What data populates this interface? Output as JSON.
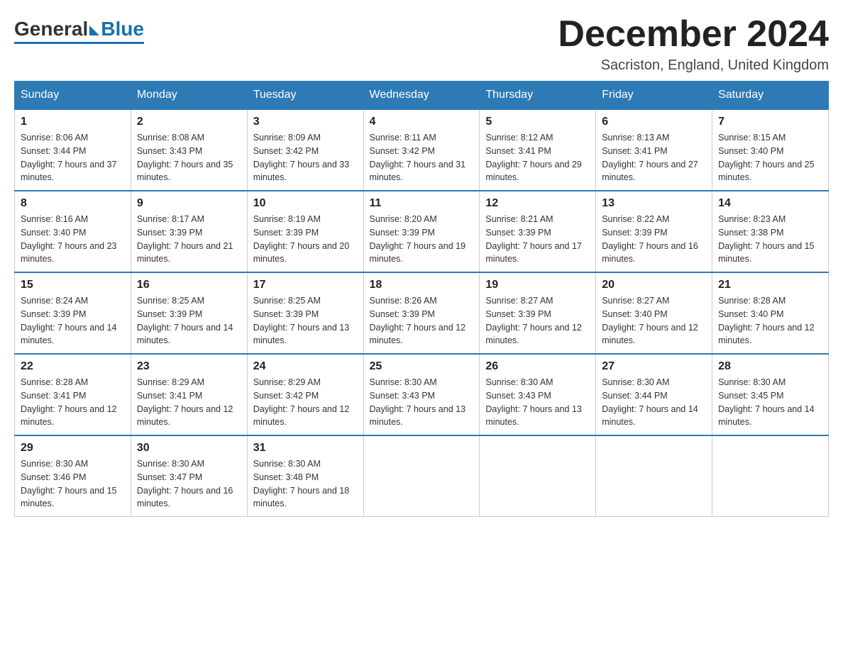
{
  "header": {
    "logo_general": "General",
    "logo_blue": "Blue",
    "month_title": "December 2024",
    "location": "Sacriston, England, United Kingdom"
  },
  "weekdays": [
    "Sunday",
    "Monday",
    "Tuesday",
    "Wednesday",
    "Thursday",
    "Friday",
    "Saturday"
  ],
  "weeks": [
    [
      {
        "day": "1",
        "sunrise": "8:06 AM",
        "sunset": "3:44 PM",
        "daylight": "7 hours and 37 minutes."
      },
      {
        "day": "2",
        "sunrise": "8:08 AM",
        "sunset": "3:43 PM",
        "daylight": "7 hours and 35 minutes."
      },
      {
        "day": "3",
        "sunrise": "8:09 AM",
        "sunset": "3:42 PM",
        "daylight": "7 hours and 33 minutes."
      },
      {
        "day": "4",
        "sunrise": "8:11 AM",
        "sunset": "3:42 PM",
        "daylight": "7 hours and 31 minutes."
      },
      {
        "day": "5",
        "sunrise": "8:12 AM",
        "sunset": "3:41 PM",
        "daylight": "7 hours and 29 minutes."
      },
      {
        "day": "6",
        "sunrise": "8:13 AM",
        "sunset": "3:41 PM",
        "daylight": "7 hours and 27 minutes."
      },
      {
        "day": "7",
        "sunrise": "8:15 AM",
        "sunset": "3:40 PM",
        "daylight": "7 hours and 25 minutes."
      }
    ],
    [
      {
        "day": "8",
        "sunrise": "8:16 AM",
        "sunset": "3:40 PM",
        "daylight": "7 hours and 23 minutes."
      },
      {
        "day": "9",
        "sunrise": "8:17 AM",
        "sunset": "3:39 PM",
        "daylight": "7 hours and 21 minutes."
      },
      {
        "day": "10",
        "sunrise": "8:19 AM",
        "sunset": "3:39 PM",
        "daylight": "7 hours and 20 minutes."
      },
      {
        "day": "11",
        "sunrise": "8:20 AM",
        "sunset": "3:39 PM",
        "daylight": "7 hours and 19 minutes."
      },
      {
        "day": "12",
        "sunrise": "8:21 AM",
        "sunset": "3:39 PM",
        "daylight": "7 hours and 17 minutes."
      },
      {
        "day": "13",
        "sunrise": "8:22 AM",
        "sunset": "3:39 PM",
        "daylight": "7 hours and 16 minutes."
      },
      {
        "day": "14",
        "sunrise": "8:23 AM",
        "sunset": "3:38 PM",
        "daylight": "7 hours and 15 minutes."
      }
    ],
    [
      {
        "day": "15",
        "sunrise": "8:24 AM",
        "sunset": "3:39 PM",
        "daylight": "7 hours and 14 minutes."
      },
      {
        "day": "16",
        "sunrise": "8:25 AM",
        "sunset": "3:39 PM",
        "daylight": "7 hours and 14 minutes."
      },
      {
        "day": "17",
        "sunrise": "8:25 AM",
        "sunset": "3:39 PM",
        "daylight": "7 hours and 13 minutes."
      },
      {
        "day": "18",
        "sunrise": "8:26 AM",
        "sunset": "3:39 PM",
        "daylight": "7 hours and 12 minutes."
      },
      {
        "day": "19",
        "sunrise": "8:27 AM",
        "sunset": "3:39 PM",
        "daylight": "7 hours and 12 minutes."
      },
      {
        "day": "20",
        "sunrise": "8:27 AM",
        "sunset": "3:40 PM",
        "daylight": "7 hours and 12 minutes."
      },
      {
        "day": "21",
        "sunrise": "8:28 AM",
        "sunset": "3:40 PM",
        "daylight": "7 hours and 12 minutes."
      }
    ],
    [
      {
        "day": "22",
        "sunrise": "8:28 AM",
        "sunset": "3:41 PM",
        "daylight": "7 hours and 12 minutes."
      },
      {
        "day": "23",
        "sunrise": "8:29 AM",
        "sunset": "3:41 PM",
        "daylight": "7 hours and 12 minutes."
      },
      {
        "day": "24",
        "sunrise": "8:29 AM",
        "sunset": "3:42 PM",
        "daylight": "7 hours and 12 minutes."
      },
      {
        "day": "25",
        "sunrise": "8:30 AM",
        "sunset": "3:43 PM",
        "daylight": "7 hours and 13 minutes."
      },
      {
        "day": "26",
        "sunrise": "8:30 AM",
        "sunset": "3:43 PM",
        "daylight": "7 hours and 13 minutes."
      },
      {
        "day": "27",
        "sunrise": "8:30 AM",
        "sunset": "3:44 PM",
        "daylight": "7 hours and 14 minutes."
      },
      {
        "day": "28",
        "sunrise": "8:30 AM",
        "sunset": "3:45 PM",
        "daylight": "7 hours and 14 minutes."
      }
    ],
    [
      {
        "day": "29",
        "sunrise": "8:30 AM",
        "sunset": "3:46 PM",
        "daylight": "7 hours and 15 minutes."
      },
      {
        "day": "30",
        "sunrise": "8:30 AM",
        "sunset": "3:47 PM",
        "daylight": "7 hours and 16 minutes."
      },
      {
        "day": "31",
        "sunrise": "8:30 AM",
        "sunset": "3:48 PM",
        "daylight": "7 hours and 18 minutes."
      },
      null,
      null,
      null,
      null
    ]
  ]
}
